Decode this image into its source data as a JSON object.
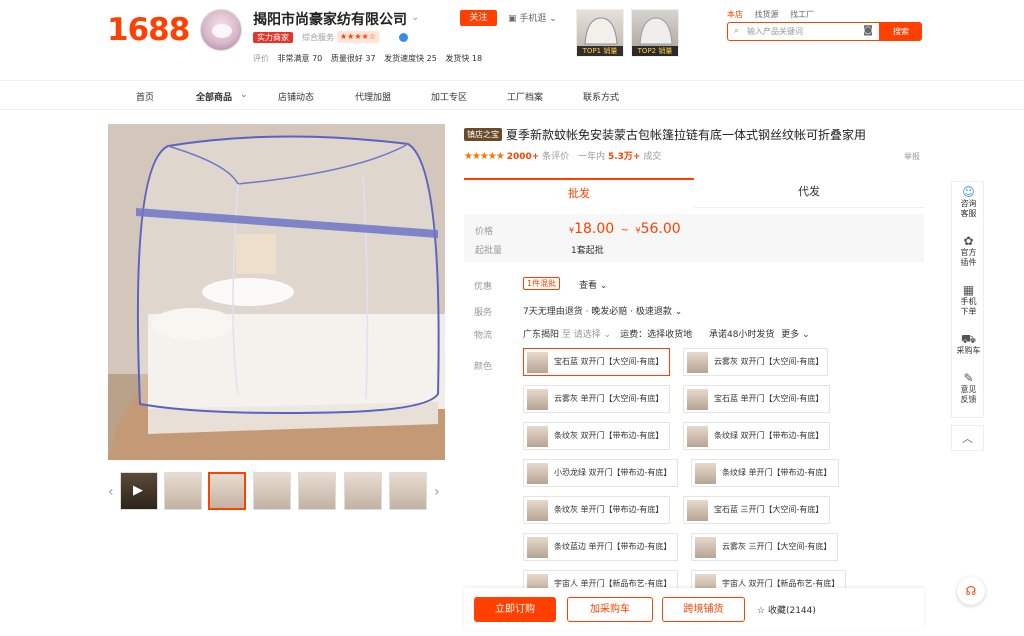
{
  "header": {
    "logo": "1688",
    "shop_name": "揭阳市尚豪家纺有限公司",
    "follow": "关注",
    "mobile": "手机逛",
    "badge": "实力商家",
    "service_label": "综合服务",
    "service_stars": "★★★★☆",
    "ratings_label": "评价",
    "ratings": [
      "非常满意 70",
      "质量很好 37",
      "发货速度快 25",
      "发货快 18"
    ],
    "top1": "TOP1 销量",
    "top2": "TOP2 销量",
    "search_tabs": [
      "本店",
      "找货源",
      "找工厂"
    ],
    "search_placeholder": "输入产品关键词",
    "search_button": "搜索"
  },
  "nav": [
    "首页",
    "全部商品",
    "店铺动态",
    "代理加盟",
    "加工专区",
    "工厂档案",
    "联系方式"
  ],
  "product": {
    "tag": "镇店之宝",
    "title": "夏季新款蚊帐免安装蒙古包帐篷拉链有底一体式钢丝纹帐可折叠家用",
    "stars": "★★★★★",
    "review_count": "2000+",
    "review_label": "条评价",
    "sales_label": "一年内",
    "sales": "5.3万+",
    "sales_unit": "成交",
    "report": "举报"
  },
  "tabs": [
    "批发",
    "代发"
  ],
  "price": {
    "price_label": "价格",
    "currency": "¥",
    "low": "18.00",
    "sep": "~",
    "high": "56.00",
    "min_label": "起批量",
    "min": "1套起批"
  },
  "promo": {
    "label": "优惠",
    "tag": "1件混批",
    "more": "查看"
  },
  "service": {
    "label": "服务",
    "text": "7天无理由退货 · 晚发必赔 · 极速退款"
  },
  "logistics": {
    "label": "物流",
    "from": "广东揭阳",
    "to": "至",
    "select": "请选择",
    "freight": "运费：选择收货地",
    "promise": "承诺48小时发货",
    "more": "更多"
  },
  "color": {
    "label": "颜色",
    "options": [
      "宝石蓝 双开门【大空间-有底】",
      "云雾灰 双开门【大空间-有底】",
      "云雾灰 单开门【大空间-有底】",
      "宝石蓝 单开门【大空间-有底】",
      "条纹灰 双开门【带布边-有底】",
      "条纹绿 双开门【带布边-有底】",
      "小恐龙绿 双开门【带布边-有底】",
      "条纹绿 单开门【带布边-有底】",
      "条纹灰 单开门【带布边-有底】",
      "宝石蓝 三开门【大空间-有底】",
      "条纹蓝边 单开门【带布边-有底】",
      "云雾灰 三开门【大空间-有底】",
      "宇宙人 单开门【新品布艺-有底】",
      "宇宙人 双开门【新品布艺-有底】"
    ]
  },
  "buybar": {
    "order": "立即订购",
    "cart": "加采购车",
    "cross": "跨境铺货",
    "fav": "收藏(2144)"
  },
  "sidebar": [
    {
      "icon": "☺",
      "label": "咨询客服"
    },
    {
      "icon": "✿",
      "label": "官方插件"
    },
    {
      "icon": "▦",
      "label": "手机下单"
    },
    {
      "icon": "⛟",
      "label": "采购车"
    },
    {
      "icon": "✎",
      "label": "意见反馈"
    }
  ],
  "accent": "#ff4000"
}
